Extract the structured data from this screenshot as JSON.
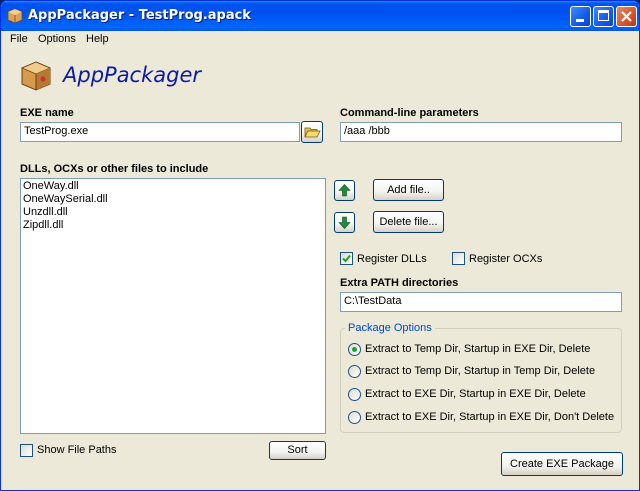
{
  "window": {
    "title": "AppPackager - TestProg.apack"
  },
  "menu": {
    "items": [
      "File",
      "Options",
      "Help"
    ]
  },
  "header": {
    "app_name": "AppPackager"
  },
  "exe": {
    "label": "EXE name",
    "value": "TestProg.exe"
  },
  "cmdline": {
    "label": "Command-line parameters",
    "value": "/aaa /bbb"
  },
  "files": {
    "label": "DLLs, OCXs or other files to include",
    "items": [
      "OneWay.dll",
      "OneWaySerial.dll",
      "Unzdll.dll",
      "Zipdll.dll"
    ],
    "show_paths_label": "Show File Paths",
    "show_paths_checked": false,
    "sort_label": "Sort"
  },
  "actions": {
    "add_label": "Add file..",
    "delete_label": "Delete file..."
  },
  "register": {
    "dlls_label": "Register DLLs",
    "dlls_checked": true,
    "ocxs_label": "Register OCXs",
    "ocxs_checked": false
  },
  "path": {
    "label": "Extra PATH directories",
    "value": "C:\\TestData"
  },
  "package_options": {
    "title": "Package Options",
    "options": [
      "Extract to Temp Dir, Startup in EXE Dir, Delete",
      "Extract to Temp Dir, Startup in Temp Dir, Delete",
      "Extract to EXE Dir, Startup in EXE Dir, Delete",
      "Extract to EXE Dir, Startup in EXE Dir, Don't Delete"
    ],
    "selected": "Extract to Temp Dir, Startup in EXE Dir, Delete"
  },
  "create": {
    "label": "Create EXE Package"
  },
  "colors": {
    "title_bar": "#0054e3",
    "logo_text": "#0d1aa8",
    "group_title": "#0046d5",
    "arrow_green": "#1e8a3a"
  },
  "icons": {
    "app": "package-box-icon",
    "browse": "folder-open-icon",
    "move_up": "arrow-up-icon",
    "move_down": "arrow-down-icon"
  }
}
